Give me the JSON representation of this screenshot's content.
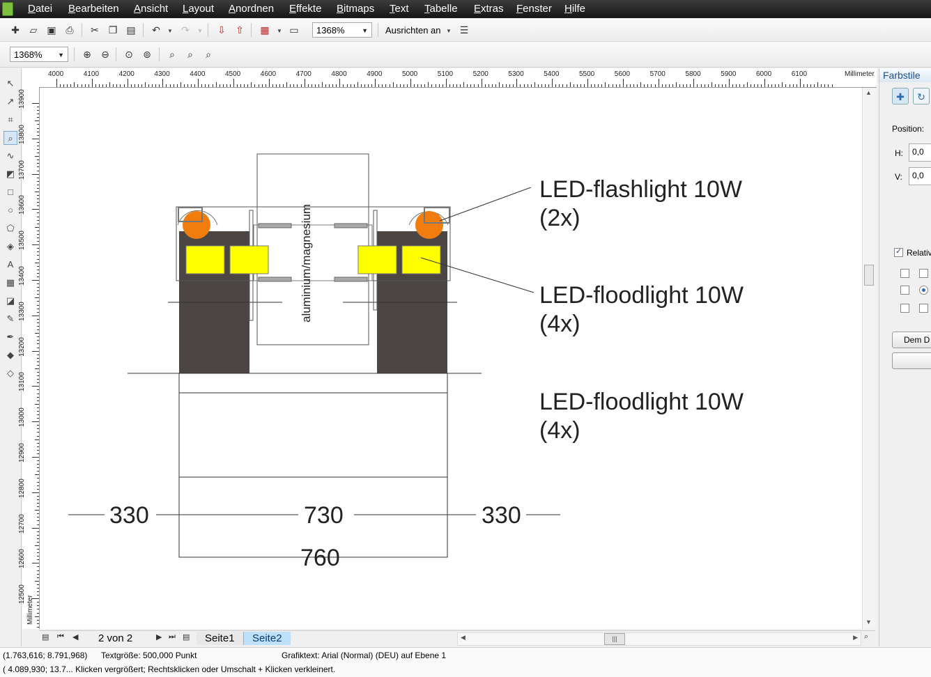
{
  "menu": [
    {
      "acc": "D",
      "rest": "atei"
    },
    {
      "acc": "B",
      "rest": "earbeiten"
    },
    {
      "acc": "A",
      "rest": "nsicht"
    },
    {
      "acc": "L",
      "rest": "ayout"
    },
    {
      "acc": "A",
      "rest": "nordnen"
    },
    {
      "acc": "E",
      "rest": "ffekte"
    },
    {
      "acc": "B",
      "rest": "itmaps"
    },
    {
      "acc": "T",
      "rest": "ext"
    },
    {
      "acc": "T",
      "rest": "abelle"
    },
    {
      "acc": "E",
      "rest": "xtras"
    },
    {
      "acc": "F",
      "rest": "enster"
    },
    {
      "acc": "H",
      "rest": "ilfe"
    }
  ],
  "toolbar": {
    "zoom_value": "1368%",
    "align_label": "Ausrichten an"
  },
  "zoombar": {
    "zoom_value": "1368%"
  },
  "ruler": {
    "unit": "Millimeter",
    "h_ticks": [
      "4000",
      "4100",
      "4200",
      "4300",
      "4400",
      "4500",
      "4600",
      "4700",
      "4800",
      "4900",
      "5000",
      "5100",
      "5200",
      "5300",
      "5400",
      "5500",
      "5600",
      "5700",
      "5800",
      "5900",
      "6000",
      "6100"
    ],
    "v_ticks": [
      "13900",
      "13800",
      "13700",
      "13600",
      "13500",
      "13400",
      "13300",
      "13200",
      "13100",
      "13000",
      "12900",
      "12800",
      "12700",
      "12600",
      "12500"
    ]
  },
  "drawing": {
    "vertical_label": "aluminium/magnesium",
    "callouts": [
      {
        "line1": "LED-flashlight 10W",
        "line2": "(2x)"
      },
      {
        "line1": "LED-floodlight 10W",
        "line2": "(4x)"
      },
      {
        "line1": "LED-floodlight 10W",
        "line2": "(4x)"
      }
    ],
    "dimensions": [
      "330",
      "730",
      "330",
      "760"
    ],
    "colors": {
      "dark_block": "#4b4643",
      "light_yellow": "#ffff00",
      "light_orange": "#f07d0e"
    }
  },
  "pages": {
    "counter": "2 von 2",
    "tabs": [
      "Seite1",
      "Seite2"
    ],
    "active": "Seite2"
  },
  "status": {
    "line1_coords": "(1.763,616; 8.791,968)",
    "line1_size": "Textgröße: 500,000 Punkt",
    "line1_object": "Grafiktext: Arial (Normal) (DEU) auf Ebene 1",
    "line2": "( 4.089,930; 13.7... Klicken vergrößert; Rechtsklicken oder Umschalt + Klicken verkleinert."
  },
  "docker": {
    "title": "Farbstile",
    "position_label": "Position:",
    "h_label": "H:",
    "h_value": "0,0",
    "v_label": "V:",
    "v_value": "0,0",
    "relative_label": "Relativ",
    "button_label": "Dem D"
  }
}
